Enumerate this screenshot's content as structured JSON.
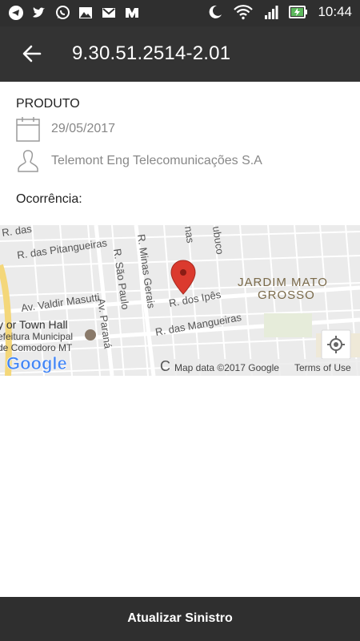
{
  "status_bar": {
    "time": "10:44",
    "left_icons": [
      "telegram-icon",
      "twitter-icon",
      "whatsapp-icon",
      "gallery-icon",
      "gmail-icon",
      "app-icon"
    ],
    "right_icons": [
      "moon-icon",
      "wifi-icon",
      "signal-icon",
      "battery-icon"
    ]
  },
  "appbar": {
    "title": "9.30.51.2514-2.01"
  },
  "details": {
    "section_label": "PRODUTO",
    "date": "29/05/2017",
    "company": "Telemont Eng Telecomunicações S.A",
    "occurrence_label": "Ocorrência:"
  },
  "map": {
    "streets": [
      "R. das Pitangueiras",
      "R. Minas Gerais",
      "R. São Paulo",
      "Av. Valdir Masutti",
      "Av. Paraná",
      "R. dos Ipês",
      "R. das Mangueiras",
      "R. das",
      "nas",
      "ubuco"
    ],
    "district": [
      "JARDIM MATO",
      "GROSSO"
    ],
    "poi": [
      "y or Town Hall",
      "efeitura Municipal",
      "de Comodoro MT"
    ],
    "partial_label": "C",
    "attribution": "Map data ©2017 Google",
    "terms": "Terms of Use",
    "logo": "Google",
    "marker_color": "#db3a2e"
  },
  "bottom_button": {
    "label": "Atualizar Sinistro"
  }
}
